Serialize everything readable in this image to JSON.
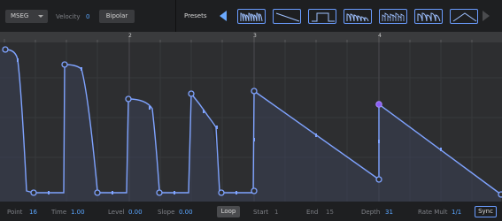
{
  "toolbar": {
    "mode_select": "MSEG",
    "velocity_label": "Velocity",
    "velocity_value": "0",
    "bipolar_label": "Bipolar",
    "presets_label": "Presets"
  },
  "ruler": {
    "marks": [
      "2",
      "3",
      "4"
    ]
  },
  "bottom": {
    "point_label": "Point",
    "point_value": "16",
    "time_label": "Time",
    "time_value": "1.00",
    "level_label": "Level",
    "level_value": "0.00",
    "slope_label": "Slope",
    "slope_value": "0.00",
    "loop_label": "Loop",
    "start_label": "Start",
    "start_value": "1",
    "end_label": "End",
    "end_value": "15",
    "depth_label": "Depth",
    "depth_value": "31",
    "ratemult_label": "Rate Mult",
    "ratemult_value": "1/1",
    "sync_label": "Sync"
  },
  "colors": {
    "accent": "#6a9cff",
    "curve": "#7fa3ff",
    "selected_point": "#8b5cf6",
    "background": "#2d2e30"
  },
  "icons": [
    "caret-down-icon",
    "arrow-left-icon",
    "arrow-right-icon"
  ]
}
